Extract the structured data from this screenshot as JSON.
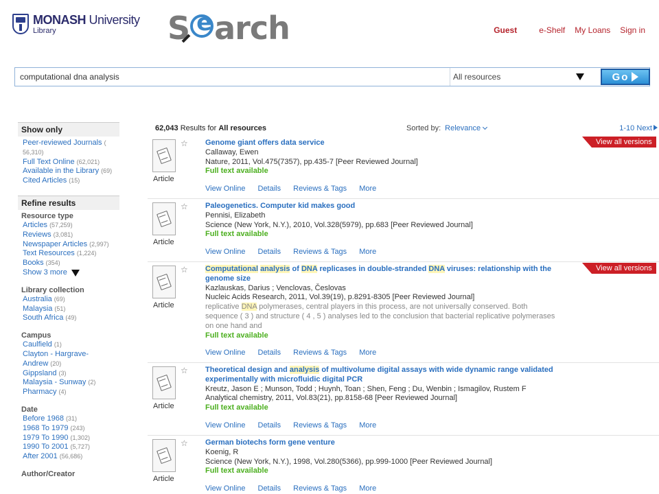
{
  "header": {
    "logo_name_bold": "MONASH",
    "logo_name_rest": " University",
    "logo_sub": "Library",
    "brand_pre": "S",
    "brand_lens": "e",
    "brand_post": "arch",
    "nav": {
      "guest": "Guest",
      "eshelf": "e-Shelf",
      "loans": "My Loans",
      "signin": "Sign in"
    }
  },
  "search": {
    "query": "computational dna analysis",
    "scope": "All resources",
    "go_label": "Go"
  },
  "sidebar": {
    "show_only": {
      "heading": "Show only",
      "items": [
        {
          "label": "Peer-reviewed Journals",
          "count": "( 56,310)"
        },
        {
          "label": "Full Text Online",
          "count": "(62,021)"
        },
        {
          "label": "Available in the Library",
          "count": "(69)"
        },
        {
          "label": "Cited Articles",
          "count": "(15)"
        }
      ]
    },
    "refine": {
      "heading": "Refine results",
      "resource_type": {
        "heading": "Resource type",
        "items": [
          {
            "label": "Articles",
            "count": "(57,259)"
          },
          {
            "label": "Reviews",
            "count": "(3,081)"
          },
          {
            "label": "Newspaper Articles",
            "count": "(2,997)"
          },
          {
            "label": "Text Resources",
            "count": "(1,224)"
          },
          {
            "label": "Books",
            "count": "(354)"
          }
        ],
        "show_more": "Show  3  more"
      },
      "library_collection": {
        "heading": "Library collection",
        "items": [
          {
            "label": "Australia",
            "count": "(69)"
          },
          {
            "label": "Malaysia",
            "count": "(51)"
          },
          {
            "label": "South Africa",
            "count": "(49)"
          }
        ]
      },
      "campus": {
        "heading": "Campus",
        "items": [
          {
            "label": "Caulfield",
            "count": "(1)"
          },
          {
            "label": "Clayton - Hargrave-Andrew",
            "count": "(20)"
          },
          {
            "label": "Gippsland",
            "count": "(3)"
          },
          {
            "label": "Malaysia - Sunway",
            "count": "(2)"
          },
          {
            "label": "Pharmacy",
            "count": "(4)"
          }
        ]
      },
      "date": {
        "heading": "Date",
        "items": [
          {
            "label": "Before 1968",
            "count": "(31)"
          },
          {
            "label": "1968 To 1979",
            "count": "(243)"
          },
          {
            "label": "1979 To 1990",
            "count": "(1,302)"
          },
          {
            "label": "1990 To 2001",
            "count": "(5,727)"
          },
          {
            "label": "After 2001",
            "count": "(56,686)"
          }
        ]
      },
      "author": {
        "heading": "Author/Creator"
      }
    }
  },
  "results_header": {
    "count": "62,043",
    "results_for": " Results for ",
    "scope": "All resources",
    "sorted_by": "Sorted by:",
    "sort_value": "Relevance",
    "range": "1-10",
    "next": "Next"
  },
  "results": [
    {
      "type": "Article",
      "title": "Genome giant offers data service",
      "authors": "Callaway, Ewen",
      "source": "Nature, 2011, Vol.475(7357), pp.435-7 [Peer Reviewed Journal]",
      "fulltext": "Full text available",
      "versions": "View all versions"
    },
    {
      "type": "Article",
      "title": "Paleogenetics. Computer kid makes good",
      "authors": "Pennisi, Elizabeth",
      "source": "Science (New York, N.Y.), 2010, Vol.328(5979), pp.683 [Peer Reviewed Journal]",
      "fulltext": "Full text available"
    },
    {
      "type": "Article",
      "title_parts": [
        {
          "t": "Computational",
          "hl": true
        },
        {
          "t": " ",
          "hl": false
        },
        {
          "t": "analysis",
          "hl": true
        },
        {
          "t": " of ",
          "hl": false
        },
        {
          "t": "DNA",
          "hl": true
        },
        {
          "t": " replicases in double-stranded ",
          "hl": false
        },
        {
          "t": "DNA",
          "hl": true
        },
        {
          "t": " viruses: relationship with the genome size",
          "hl": false
        }
      ],
      "authors": "Kazlauskas, Darius ; Venclovas, Česlovas",
      "source": "Nucleic Acids Research, 2011, Vol.39(19), p.8291-8305 [Peer Reviewed Journal]",
      "snippet_parts": [
        {
          "t": "replicative ",
          "hl": false
        },
        {
          "t": "DNA",
          "hl": true
        },
        {
          "t": " polymerases, central players in this process, are not universally conserved. Both sequence ( 3 ) and structure ( 4 , 5 ) analyses led to the conclusion that bacterial replicative polymerases on one hand and",
          "hl": false
        }
      ],
      "fulltext": "Full text available",
      "versions": "View all versions"
    },
    {
      "type": "Article",
      "title_parts": [
        {
          "t": "Theoretical design and ",
          "hl": false
        },
        {
          "t": "analysis",
          "hl": true
        },
        {
          "t": " of multivolume digital assays with wide dynamic range validated experimentally with microfluidic digital PCR",
          "hl": false
        }
      ],
      "authors": "Kreutz, Jason E ; Munson, Todd ; Huynh, Toan ; Shen, Feng ; Du, Wenbin ; Ismagilov, Rustem F",
      "source": "Analytical chemistry, 2011, Vol.83(21), pp.8158-68 [Peer Reviewed Journal]",
      "fulltext": "Full text available"
    },
    {
      "type": "Article",
      "title": "German biotechs form gene venture",
      "authors": "Koenig, R",
      "source": "Science (New York, N.Y.), 1998, Vol.280(5366), pp.999-1000 [Peer Reviewed Journal]",
      "fulltext": "Full text available"
    }
  ],
  "actions": {
    "view_online": "View Online",
    "details": "Details",
    "reviews": "Reviews & Tags",
    "more": "More"
  }
}
